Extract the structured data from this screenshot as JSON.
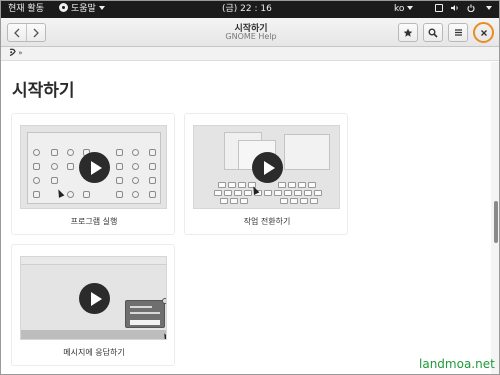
{
  "topbar": {
    "activities": "현재 활동",
    "app_menu": "도움말",
    "clock": "(금) 22 : 16",
    "lang": "ko"
  },
  "headerbar": {
    "title": "시작하기",
    "subtitle": "GNOME Help",
    "back_icon": "chevron-left-icon",
    "forward_icon": "chevron-right-icon",
    "bookmark_icon": "star-icon",
    "search_icon": "search-icon",
    "menu_icon": "hamburger-menu-icon",
    "close_icon": "close-icon",
    "close_highlight_color": "#ee8a23"
  },
  "breadcrumb": {
    "separator": "»"
  },
  "main": {
    "title": "시작하기",
    "cards": [
      {
        "label": "프로그램 실행"
      },
      {
        "label": "작업 전환하기"
      },
      {
        "label": "메시지에 응답하기"
      }
    ]
  },
  "watermark": "landmoa.net"
}
